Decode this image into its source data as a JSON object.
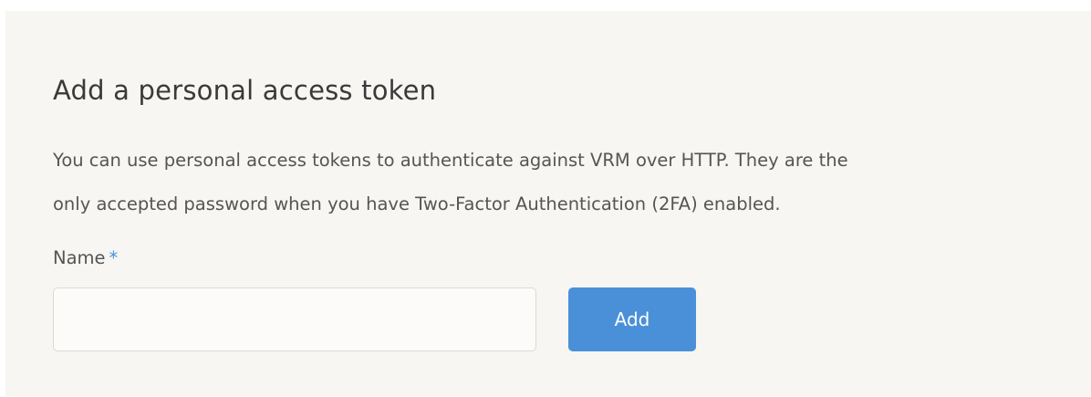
{
  "form": {
    "title": "Add a personal access token",
    "description_lines": [
      "You can use personal access tokens to authenticate against VRM over HTTP. They are the",
      "only accepted password when you have Two-Factor Authentication (2FA) enabled."
    ],
    "name_label": "Name",
    "required_marker": "*",
    "name_value": "",
    "name_placeholder": "",
    "add_label": "Add"
  },
  "colors": {
    "panel_background": "#f7f6f3",
    "accent": "#4a90d9",
    "text": "#555555"
  }
}
